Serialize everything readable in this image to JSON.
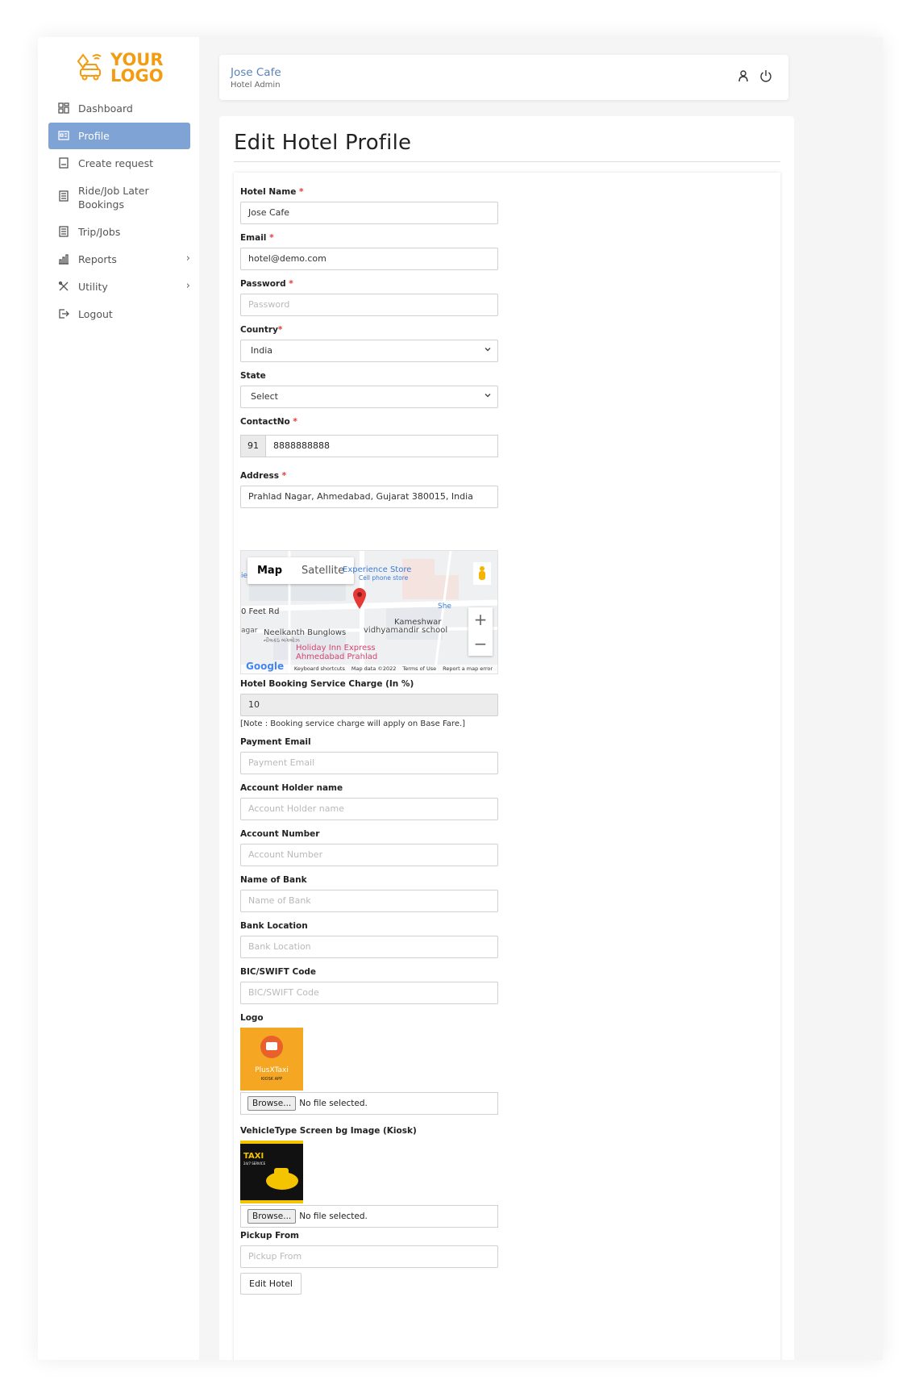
{
  "brand": {
    "line1": "YOUR",
    "line2": "LOGO",
    "color": "#f39c12"
  },
  "sidebar": {
    "items": [
      {
        "label": "Dashboard",
        "icon": "dashboard-icon"
      },
      {
        "label": "Profile",
        "icon": "profile-card-icon",
        "active": true
      },
      {
        "label": "Create request",
        "icon": "request-icon"
      },
      {
        "label": "Ride/Job Later Bookings",
        "icon": "bookings-icon"
      },
      {
        "label": "Trip/Jobs",
        "icon": "trips-icon"
      },
      {
        "label": "Reports",
        "icon": "reports-icon",
        "chevron": "›"
      },
      {
        "label": "Utility",
        "icon": "utility-icon",
        "chevron": "›"
      },
      {
        "label": "Logout",
        "icon": "logout-icon"
      }
    ]
  },
  "header": {
    "title": "Jose Cafe",
    "subtitle": "Hotel Admin"
  },
  "page": {
    "title": "Edit Hotel Profile"
  },
  "form": {
    "hotel_name": {
      "label": "Hotel Name",
      "req": "*",
      "value": "Jose Cafe"
    },
    "email": {
      "label": "Email",
      "req": "*",
      "value": "hotel@demo.com"
    },
    "password": {
      "label": "Password",
      "req": "*",
      "placeholder": "Password"
    },
    "country": {
      "label": "Country",
      "req": "*",
      "value": "India"
    },
    "state": {
      "label": "State",
      "value": "Select"
    },
    "contact": {
      "label": "ContactNo",
      "req": "*",
      "code": "91",
      "value": "8888888888"
    },
    "address": {
      "label": "Address",
      "req": "*",
      "value": "Prahlad Nagar, Ahmedabad, Gujarat 380015, India"
    },
    "map": {
      "tab_map": "Map",
      "tab_satellite": "Satellite",
      "labels": {
        "experience": "Experience Store",
        "cellphone": "Cell phone store",
        "feet_rd": "0 Feet Rd",
        "nagar": "agar",
        "neelkanth": "Neelkanth Bunglows",
        "neelkanth_gu": "નીલકંઠ બંગલોઝ",
        "kameshwar": "Kameshwar",
        "vidhyamandir": "vidhyamandir school",
        "holiday": "Holiday Inn Express",
        "holiday2": "Ahmedabad Prahlad",
        "she": "She",
        "ie": "ie"
      },
      "zoom_in": "+",
      "zoom_out": "−",
      "google": "Google",
      "footer": [
        "Keyboard shortcuts",
        "Map data ©2022",
        "Terms of Use",
        "Report a map error"
      ]
    },
    "service_charge": {
      "label": "Hotel Booking Service Charge (In %)",
      "value": "10",
      "note": "[Note : Booking service charge will apply on Base Fare.]"
    },
    "payment_email": {
      "label": "Payment Email",
      "placeholder": "Payment Email"
    },
    "account_holder": {
      "label": "Account Holder name",
      "placeholder": "Account Holder name"
    },
    "account_number": {
      "label": "Account Number",
      "placeholder": "Account Number"
    },
    "bank_name": {
      "label": "Name of Bank",
      "placeholder": "Name of Bank"
    },
    "bank_location": {
      "label": "Bank Location",
      "placeholder": "Bank Location"
    },
    "swift": {
      "label": "BIC/SWIFT Code",
      "placeholder": "BIC/SWIFT Code"
    },
    "logo": {
      "label": "Logo",
      "browse": "Browse...",
      "file_status": "No file selected.",
      "image_text": "PlusXTaxi",
      "image_sub": "KIOSK APP"
    },
    "vehicle_bg": {
      "label": "VehicleType Screen bg Image (Kiosk)",
      "browse": "Browse...",
      "file_status": "No file selected.",
      "image_text": "TAXI",
      "image_sub": "24/7 SERVICE"
    },
    "pickup": {
      "label": "Pickup From",
      "placeholder": "Pickup From"
    },
    "submit": "Edit Hotel"
  }
}
